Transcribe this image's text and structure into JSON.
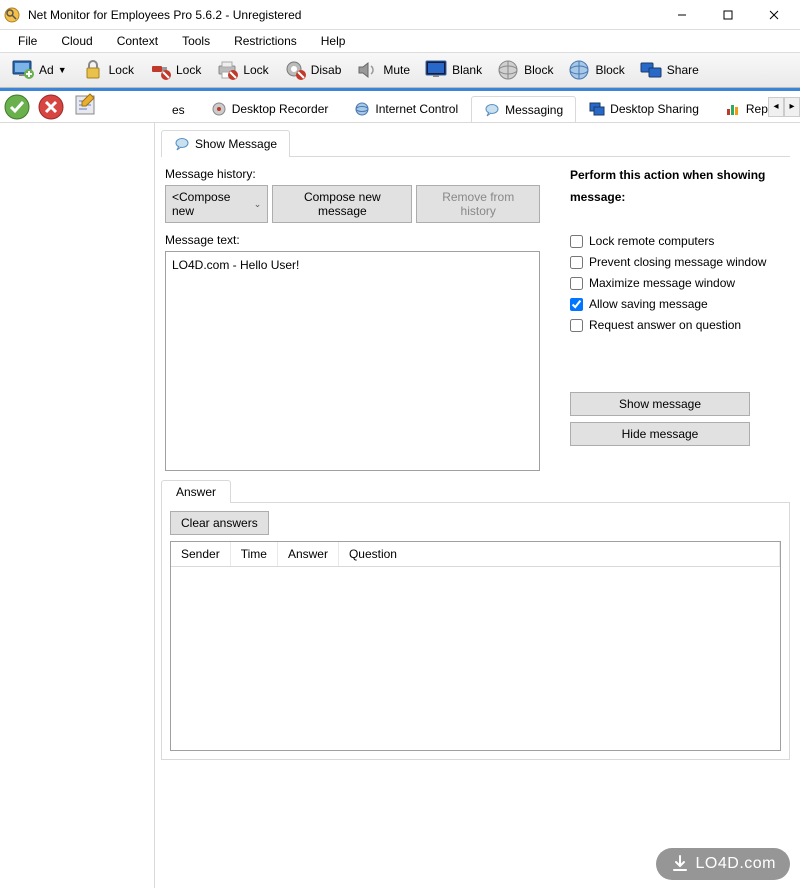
{
  "window": {
    "title": "Net Monitor for Employees Pro 5.6.2 - Unregistered"
  },
  "menu": {
    "items": [
      "File",
      "Cloud",
      "Context",
      "Tools",
      "Restrictions",
      "Help"
    ]
  },
  "toolbar": {
    "items": [
      {
        "label": "Ad",
        "icon": "monitor-add",
        "dropdown": true
      },
      {
        "label": "Lock",
        "icon": "padlock"
      },
      {
        "label": "Lock",
        "icon": "usb-lock"
      },
      {
        "label": "Lock",
        "icon": "printer-lock"
      },
      {
        "label": "Disab",
        "icon": "gear-disable"
      },
      {
        "label": "Mute",
        "icon": "speaker-mute"
      },
      {
        "label": "Blank",
        "icon": "monitor-blank"
      },
      {
        "label": "Block",
        "icon": "globe-block"
      },
      {
        "label": "Block",
        "icon": "globe-block2"
      },
      {
        "label": "Share",
        "icon": "monitors-share"
      }
    ]
  },
  "func_tabs": {
    "items": [
      {
        "label": "es",
        "icon": "",
        "partial": true
      },
      {
        "label": "Desktop Recorder",
        "icon": "recorder"
      },
      {
        "label": "Internet Control",
        "icon": "globe"
      },
      {
        "label": "Messaging",
        "icon": "speech",
        "active": true
      },
      {
        "label": "Desktop Sharing",
        "icon": "monitor-share"
      },
      {
        "label": "Reporting",
        "icon": "chart"
      }
    ]
  },
  "subtab": {
    "label": "Show Message"
  },
  "msg": {
    "history_label": "Message history:",
    "compose_dropdown": "<Compose new",
    "compose_btn": "Compose new message",
    "remove_btn": "Remove from history",
    "text_label": "Message text:",
    "text_value": "LO4D.com - Hello User!"
  },
  "action_panel": {
    "heading": "Perform this action when showing message:",
    "options": [
      {
        "label": "Lock remote computers",
        "checked": false
      },
      {
        "label": "Prevent closing message window",
        "checked": false
      },
      {
        "label": "Maximize message window",
        "checked": false
      },
      {
        "label": "Allow saving message",
        "checked": true
      },
      {
        "label": "Request answer on question",
        "checked": false
      }
    ],
    "show_btn": "Show message",
    "hide_btn": "Hide message"
  },
  "answer": {
    "tab_label": "Answer",
    "clear_btn": "Clear answers",
    "columns": [
      "Sender",
      "Time",
      "Answer",
      "Question"
    ]
  },
  "watermark": "LO4D.com"
}
